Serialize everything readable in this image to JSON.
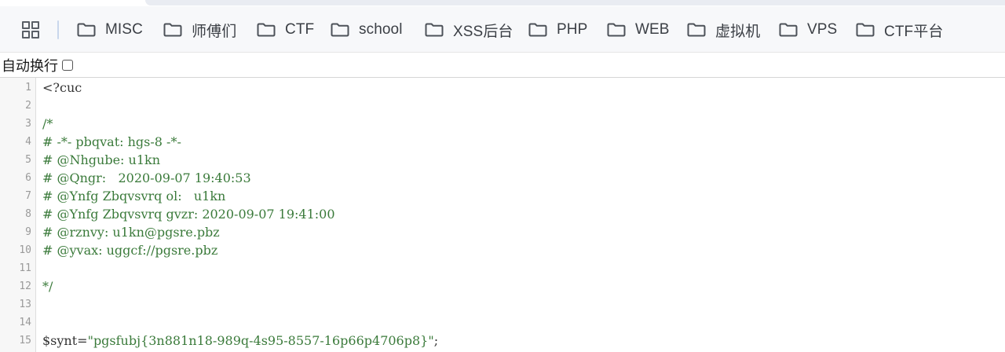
{
  "bookmarks": [
    {
      "label": "MISC",
      "icon": "folder-icon"
    },
    {
      "label": "师傅们",
      "icon": "folder-icon"
    },
    {
      "label": "CTF",
      "icon": "folder-icon"
    },
    {
      "label": "school",
      "icon": "folder-icon"
    },
    {
      "label": "XSS后台",
      "icon": "folder-icon"
    },
    {
      "label": "PHP",
      "icon": "folder-icon"
    },
    {
      "label": "WEB",
      "icon": "folder-icon"
    },
    {
      "label": "虚拟机",
      "icon": "folder-icon"
    },
    {
      "label": "VPS",
      "icon": "folder-icon"
    },
    {
      "label": "CTF平台",
      "icon": "folder-icon"
    }
  ],
  "apps_icon": "apps-grid-icon",
  "wrap_toggle": {
    "label": "自动换行",
    "checked": false
  },
  "code_lines": [
    {
      "n": "1",
      "text": "<?cuc",
      "kind": "php"
    },
    {
      "n": "2",
      "text": "",
      "kind": "plain"
    },
    {
      "n": "3",
      "text": "/*",
      "kind": "comment"
    },
    {
      "n": "4",
      "text": "# -*- pbqvat: hgs-8 -*-",
      "kind": "comment"
    },
    {
      "n": "5",
      "text": "# @Nhgube: u1kn",
      "kind": "comment"
    },
    {
      "n": "6",
      "text": "# @Qngr:   2020-09-07 19:40:53",
      "kind": "comment"
    },
    {
      "n": "7",
      "text": "# @Ynfg Zbqvsvrq ol:   u1kn",
      "kind": "comment"
    },
    {
      "n": "8",
      "text": "# @Ynfg Zbqvsvrq gvzr: 2020-09-07 19:41:00",
      "kind": "comment"
    },
    {
      "n": "9",
      "text": "# @rznvy: u1kn@pgsre.pbz",
      "kind": "comment"
    },
    {
      "n": "10",
      "text": "# @yvax: uggcf://pgsre.pbz",
      "kind": "comment"
    },
    {
      "n": "11",
      "text": "",
      "kind": "plain"
    },
    {
      "n": "12",
      "text": "*/",
      "kind": "comment"
    },
    {
      "n": "13",
      "text": "",
      "kind": "plain"
    },
    {
      "n": "14",
      "text": "",
      "kind": "plain"
    },
    {
      "n": "15",
      "text": "",
      "kind": "assign",
      "var": "$synt=",
      "str": "\"pgsfubj{3n881n18-989q-4s95-8557-16p66p4706p8}\"",
      "tail": ";"
    }
  ],
  "colors": {
    "comment": "#3a7a3a",
    "string": "#3a7a3a",
    "plain": "#333333",
    "gutter_bg": "#f7f7f7",
    "bar_bg": "#f7f8fa"
  }
}
